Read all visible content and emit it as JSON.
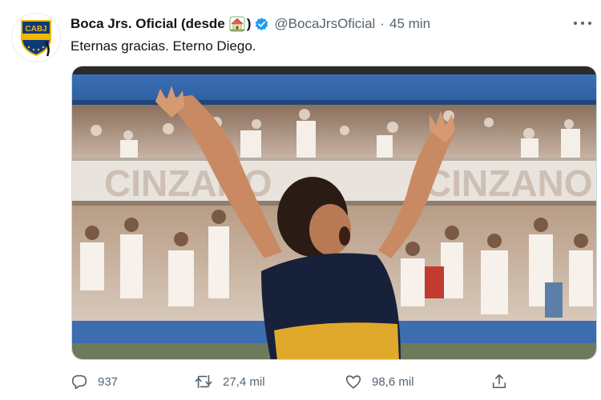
{
  "tweet": {
    "author_name": "Boca Jrs. Oficial (desde",
    "author_suffix": ")",
    "handle": "@BocaJrsOficial",
    "separator": "·",
    "timestamp": "45 min",
    "text": "Eternas gracias. Eterno Diego.",
    "avatar_logo_text": "CABJ",
    "stadium_banner_text": "CINZANO"
  },
  "actions": {
    "replies": "937",
    "retweets": "27,4 mil",
    "likes": "98,6 mil"
  },
  "icons": {
    "avatar": "cabj-crest-icon",
    "house": "house-emoji-icon",
    "verified": "verified-badge-icon",
    "more": "more-options-icon",
    "reply": "reply-icon",
    "retweet": "retweet-icon",
    "like": "heart-icon",
    "share": "share-icon"
  },
  "colors": {
    "verified": "#1d9bf0",
    "secondary_text": "#536471",
    "crest_blue": "#0b3a7a",
    "crest_gold": "#f2b705"
  }
}
